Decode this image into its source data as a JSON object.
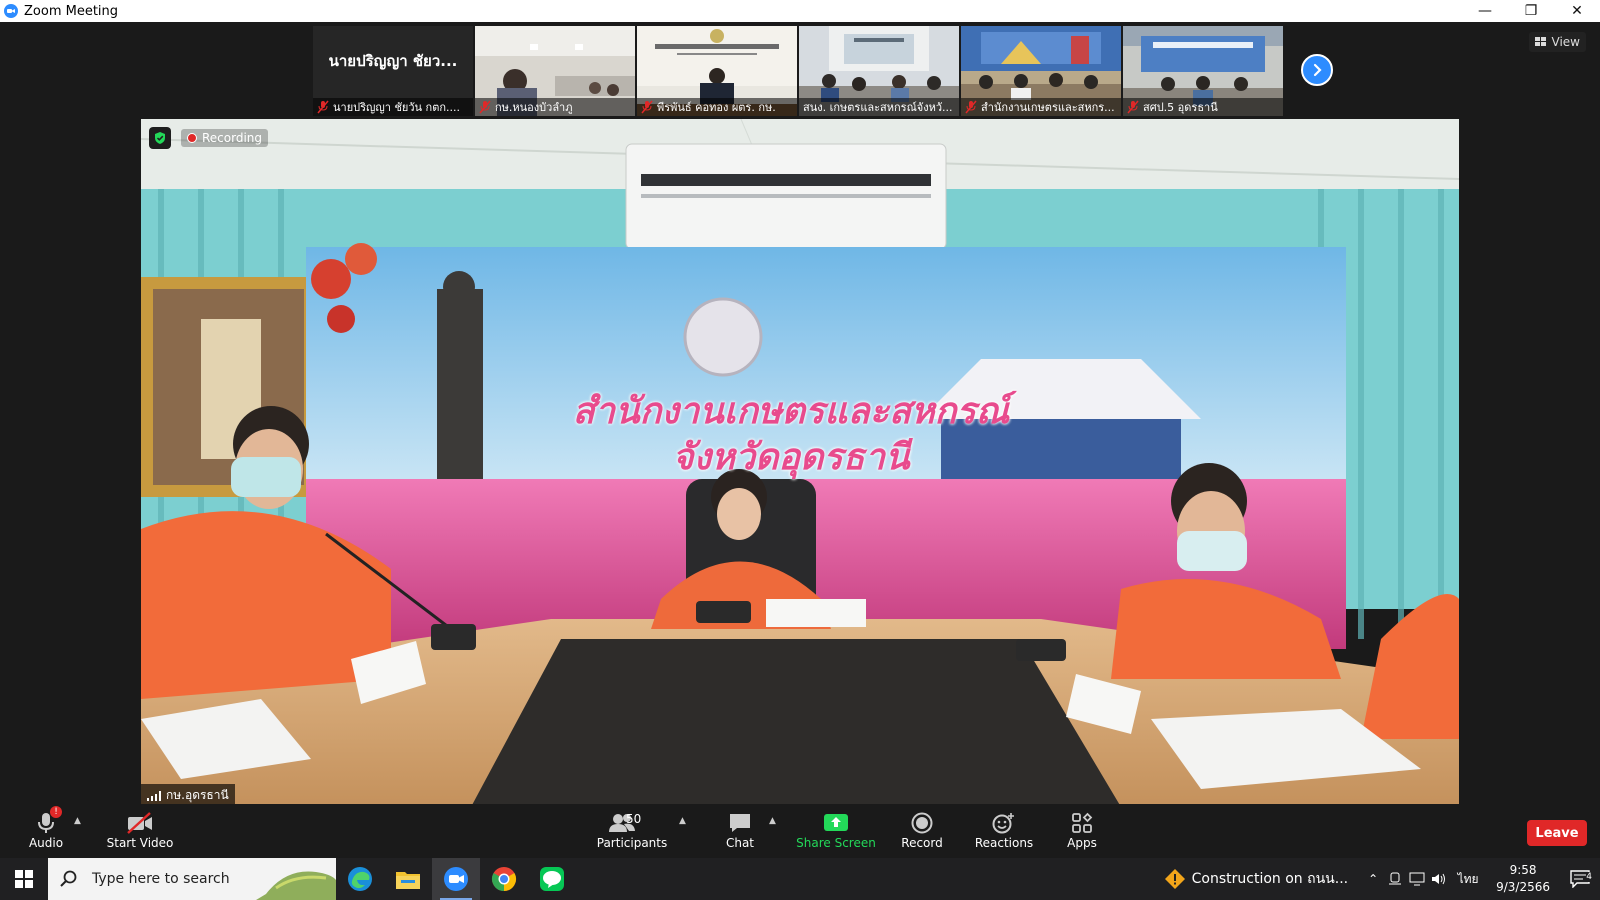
{
  "window": {
    "title": "Zoom Meeting",
    "controls": [
      "minimize",
      "restore",
      "close"
    ]
  },
  "gallery": {
    "thumbnails": [
      {
        "display_name": "นายปริญญา ชัยว...",
        "label": "นายปริญญา ชัยวัน กตก....",
        "muted": true,
        "video": false
      },
      {
        "label": "กษ.หนองบัวลำภู",
        "muted": true,
        "video": true
      },
      {
        "label": "พีรพันธ์ คอทอง ผตร. กษ.",
        "muted": true,
        "video": true
      },
      {
        "label": "สนง. เกษตรและสหกรณ์จังหวั...",
        "muted": false,
        "video": true
      },
      {
        "label": "สำนักงานเกษตรและสหกร...",
        "muted": true,
        "video": true
      },
      {
        "label": "สศป.5 อุดรธานี",
        "muted": true,
        "video": true
      }
    ],
    "next_page_icon": "chevron-right-icon",
    "view_label": "View"
  },
  "main_video": {
    "recording_label": "Recording",
    "speaker_label": "กษ.อุดรธานี",
    "banner_line1": "สำนักงานเกษตรและสหกรณ์",
    "banner_line2": "จังหวัดอุดรธานี"
  },
  "toolbar": {
    "audio_label": "Audio",
    "audio_badge": "!",
    "video_label": "Start Video",
    "participants_label": "Participants",
    "participants_count": "50",
    "chat_label": "Chat",
    "share_label": "Share Screen",
    "record_label": "Record",
    "reactions_label": "Reactions",
    "apps_label": "Apps",
    "leave_label": "Leave",
    "share_color": "#23d959",
    "leave_color": "#e02828"
  },
  "taskbar": {
    "search_placeholder": "Type here to search",
    "apps": [
      "edge-icon",
      "file-explorer-icon",
      "zoom-icon",
      "chrome-icon",
      "line-icon"
    ],
    "news_text": "Construction on ถนน...",
    "language": "ไทย",
    "time": "9:58",
    "date": "9/3/2566",
    "notification_count": "4"
  }
}
